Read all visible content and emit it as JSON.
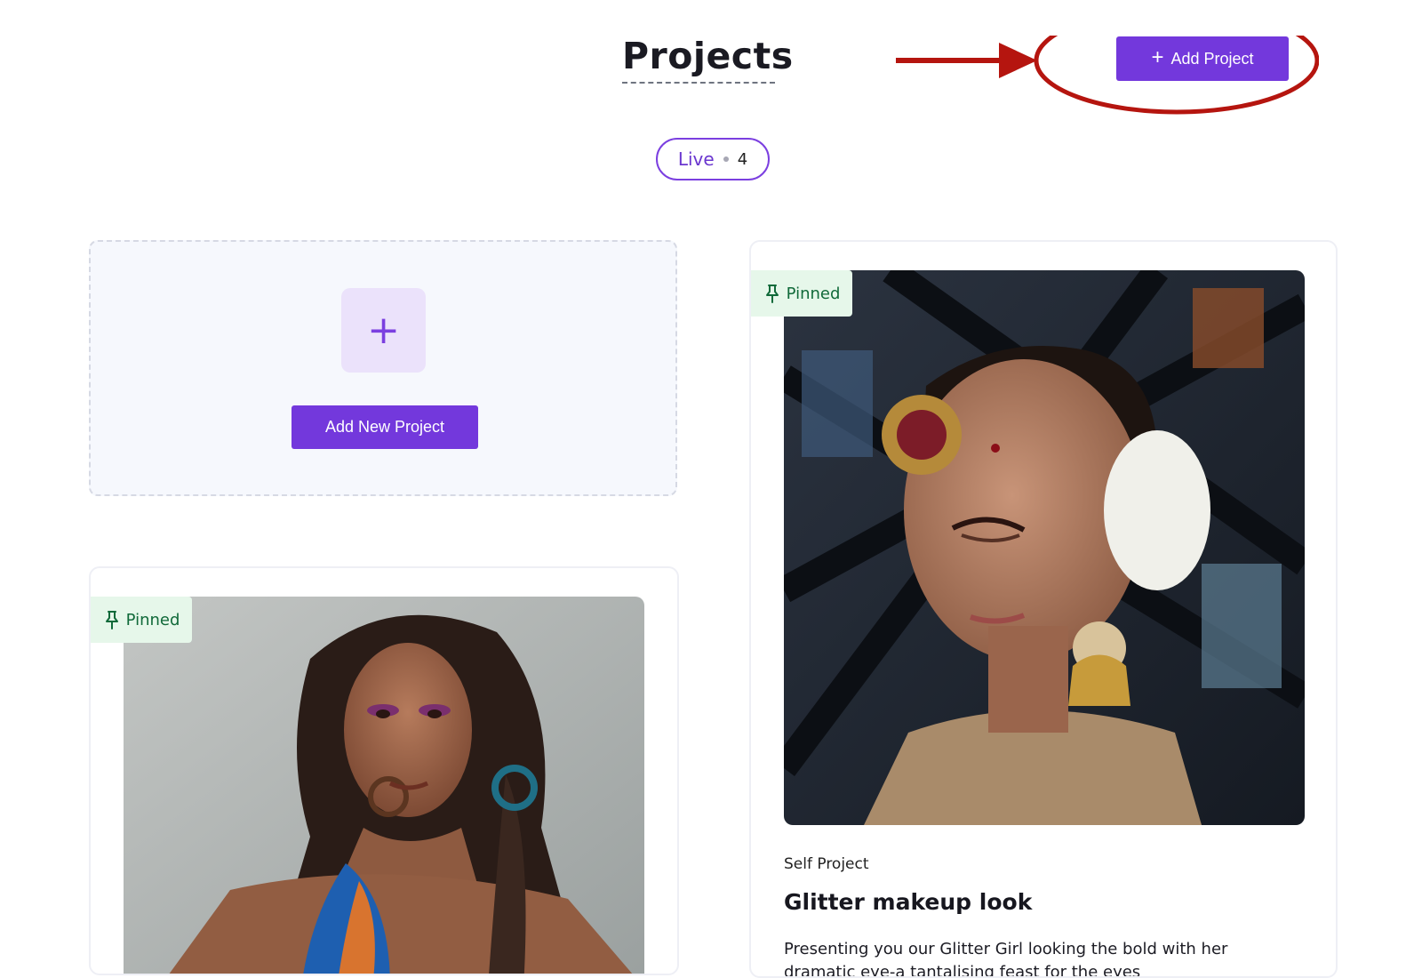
{
  "header": {
    "title": "Projects",
    "add_project_label": "Add Project"
  },
  "filter": {
    "label": "Live",
    "count": "4"
  },
  "new_project_card": {
    "button_label": "Add New Project"
  },
  "projects": [
    {
      "badge": "Pinned",
      "image_alt": "woman with purple eye makeup, braid and blue scarf"
    },
    {
      "badge": "Pinned",
      "image_alt": "bride with maang tikka and jhumka earrings",
      "type": "Self Project",
      "title": "Glitter makeup look",
      "description": "Presenting you our Glitter Girl looking the bold with her dramatic eye-a tantalising feast for the eyes"
    }
  ],
  "colors": {
    "accent": "#7338dc",
    "pinned_bg": "#e6f7ea",
    "pinned_text": "#116a3a",
    "annotation": "#b5150f"
  },
  "icons": [
    "plus-icon",
    "pin-icon",
    "annotation-arrow",
    "annotation-circle"
  ]
}
